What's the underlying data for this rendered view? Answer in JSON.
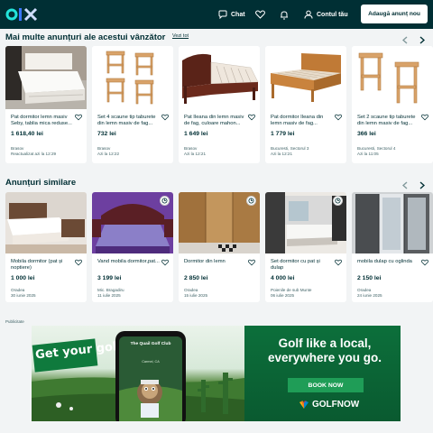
{
  "header": {
    "chat_label": "Chat",
    "account_label": "Contul tău",
    "post_label": "Adaugă anunț nou",
    "colors": {
      "background": "#002f34",
      "logo_o": "#23e5db",
      "logo_l": "#3a77ff",
      "logo_x": "#ceddff"
    }
  },
  "section_seller": {
    "title": "Mai multe anunțuri ale acestui vânzător",
    "see_all": "Vezi tot",
    "items": [
      {
        "title": "Pat dormitor lemn masiv Seby, tablia mica reduse...",
        "price": "1 618,40 lei",
        "location": "Brasov",
        "date": "Reactualizat azi la 12:29"
      },
      {
        "title": "Set 4 scaune tip taburete din lemn masiv de fag...",
        "price": "732 lei",
        "location": "Brasov",
        "date": "Azi la 12:22"
      },
      {
        "title": "Pat Ileana din lemn masiv de fag, culoare mahon...",
        "price": "1 649 lei",
        "location": "Brasov",
        "date": "Azi la 12:21"
      },
      {
        "title": "Pat dormitor Ileana din lemn masiv de fag...",
        "price": "1 779 lei",
        "location": "Bucuresti, Sectorul 3",
        "date": "Azi la 12:21"
      },
      {
        "title": "Set 2 scaune tip taburete din lemn masiv de fag...",
        "price": "366 lei",
        "location": "Bucuresti, Sectorul 4",
        "date": "Azi la 11:05"
      }
    ]
  },
  "section_similar": {
    "title": "Anunțuri similare",
    "items": [
      {
        "title": "Mobila dormitor (pat și noptiere)",
        "price": "1 000 lei",
        "location": "Oradea",
        "date": "30 iunie 2025"
      },
      {
        "title": "Vand mobila dormitor,pat...",
        "price": "3 199 lei",
        "location": "Mic. Bragadiru",
        "date": "11 iulie 2025"
      },
      {
        "title": "Dormitor din lemn",
        "price": "2 850 lei",
        "location": "Oradea",
        "date": "15 iulie 2025"
      },
      {
        "title": "Set dormitor cu pat și dulap",
        "price": "4 000 lei",
        "location": "Poienile de sub Munte",
        "date": "06 iulie 2025"
      },
      {
        "title": "mobila dulap cu oglinda",
        "price": "2 150 lei",
        "location": "Oradea",
        "date": "24 iunie 2025"
      }
    ]
  },
  "ad": {
    "label": "Publicitate",
    "get_text": "Get your golf on!",
    "phone_title": "The Quail Golf Club",
    "phone_sub": "Carmel, CA",
    "headline": "Golf like a local, everywhere you go.",
    "button": "BOOK NOW",
    "brand": "GOLFNOW"
  }
}
